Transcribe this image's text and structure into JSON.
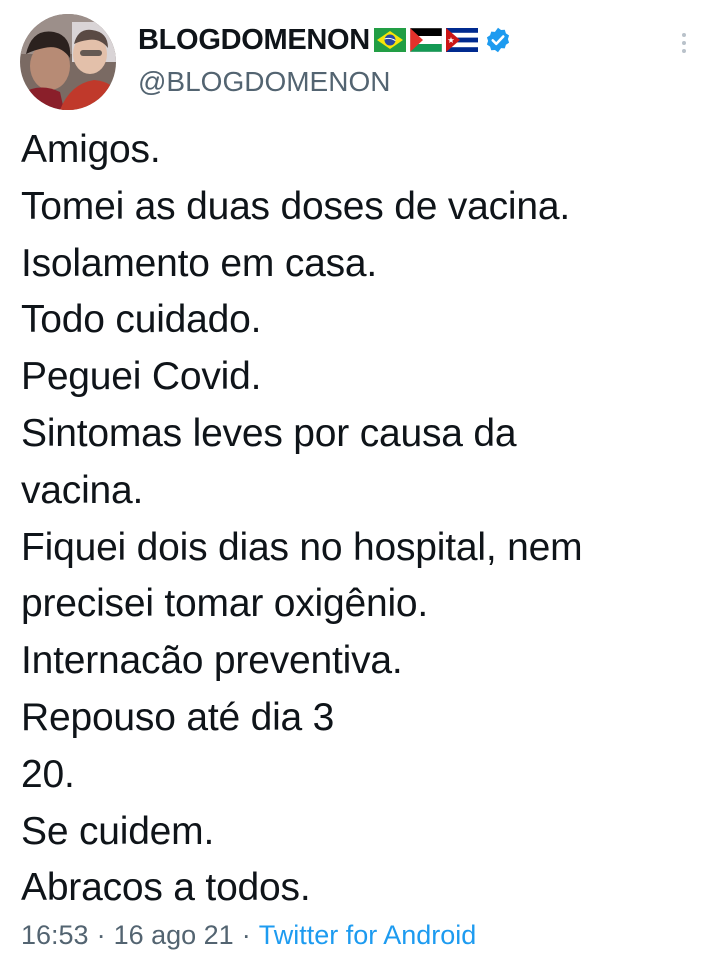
{
  "tweet": {
    "author": {
      "display_name": "BLOGDOMENON",
      "handle": "@BLOGDOMENON",
      "flags": [
        "brazil-flag",
        "palestine-flag",
        "cuba-flag"
      ],
      "verified": true
    },
    "lines": [
      "Amigos.",
      "Tomei as duas doses de vacina.",
      "Isolamento em casa.",
      "Todo cuidado.",
      "Peguei Covid.",
      "Sintomas leves por causa da",
      "vacina.",
      "Fiquei dois dias no hospital, nem",
      "precisei tomar oxigênio.",
      "Internacão preventiva.",
      "Repouso até dia 3",
      "20.",
      "Se cuidem.",
      "Abracos a todos."
    ],
    "time": "16:53",
    "date": "16 ago 21",
    "separator": "·",
    "source": "Twitter for Android"
  },
  "colors": {
    "text": "#0f1419",
    "secondary": "#536471",
    "accent": "#1d9bf0"
  }
}
